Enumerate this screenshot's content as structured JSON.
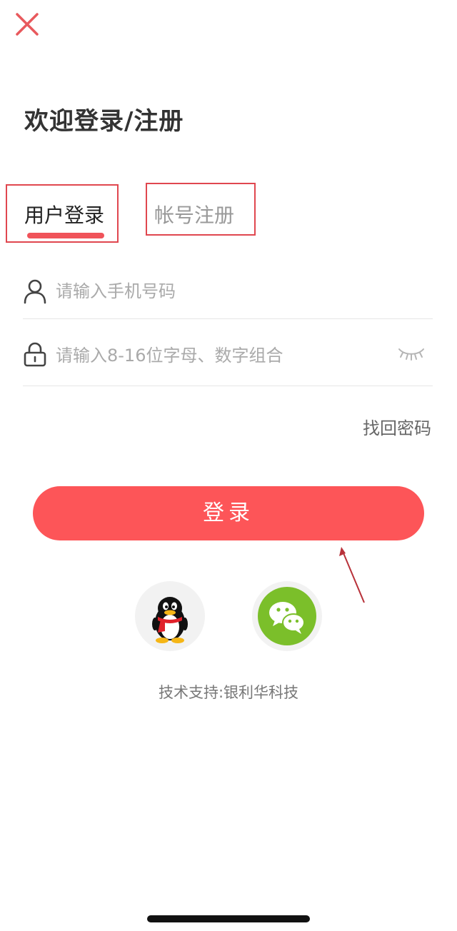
{
  "header": {
    "close_icon": "close-icon",
    "title": "欢迎登录/注册"
  },
  "tabs": [
    {
      "label": "用户登录",
      "active": true
    },
    {
      "label": "帐号注册",
      "active": false
    }
  ],
  "form": {
    "phone": {
      "icon": "user-icon",
      "value": "",
      "placeholder": "请输入手机号码"
    },
    "password": {
      "icon": "lock-icon",
      "value": "",
      "placeholder": "请输入8-16位字母、数字组合",
      "toggle_icon": "eye-closed-icon"
    },
    "forgot_label": "找回密码",
    "submit_label": "登录"
  },
  "social_login": [
    {
      "name": "QQ",
      "icon": "qq-penguin-icon"
    },
    {
      "name": "WeChat",
      "icon": "wechat-icon"
    }
  ],
  "footer": {
    "tech_support": "技术支持:银利华科技"
  },
  "colors": {
    "accent": "#fd5558",
    "annotation_border": "#e0474f",
    "wechat_green": "#7bbf2a"
  }
}
